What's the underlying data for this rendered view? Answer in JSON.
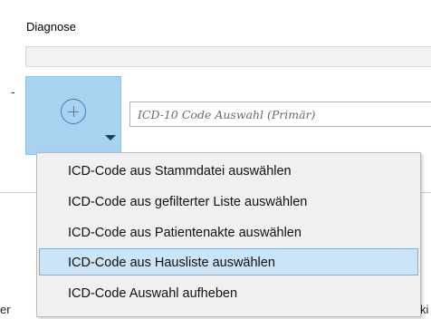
{
  "diagnosis": {
    "label": "Diagnose",
    "value": ""
  },
  "icd_selector": {
    "button_icon": "plus-circle-icon",
    "dropdown_icon": "caret-down-icon",
    "placeholder": "ICD-10 Code Auswahl (Primär)"
  },
  "background": {
    "left_fragment": "er",
    "right_fragment": "ki"
  },
  "menu": {
    "items": [
      {
        "label": "ICD-Code aus Stammdatei auswählen"
      },
      {
        "label": "ICD-Code aus gefilterter Liste auswählen"
      },
      {
        "label": "ICD-Code aus Patientenakte auswählen"
      },
      {
        "label": "ICD-Code aus Hausliste auswählen",
        "highlighted": true
      },
      {
        "label": "ICD-Code Auswahl aufheben"
      }
    ]
  },
  "colors": {
    "button_bg": "#a8d2f0",
    "highlight_bg": "#cce4f7",
    "highlight_border": "#7ab3e0"
  }
}
